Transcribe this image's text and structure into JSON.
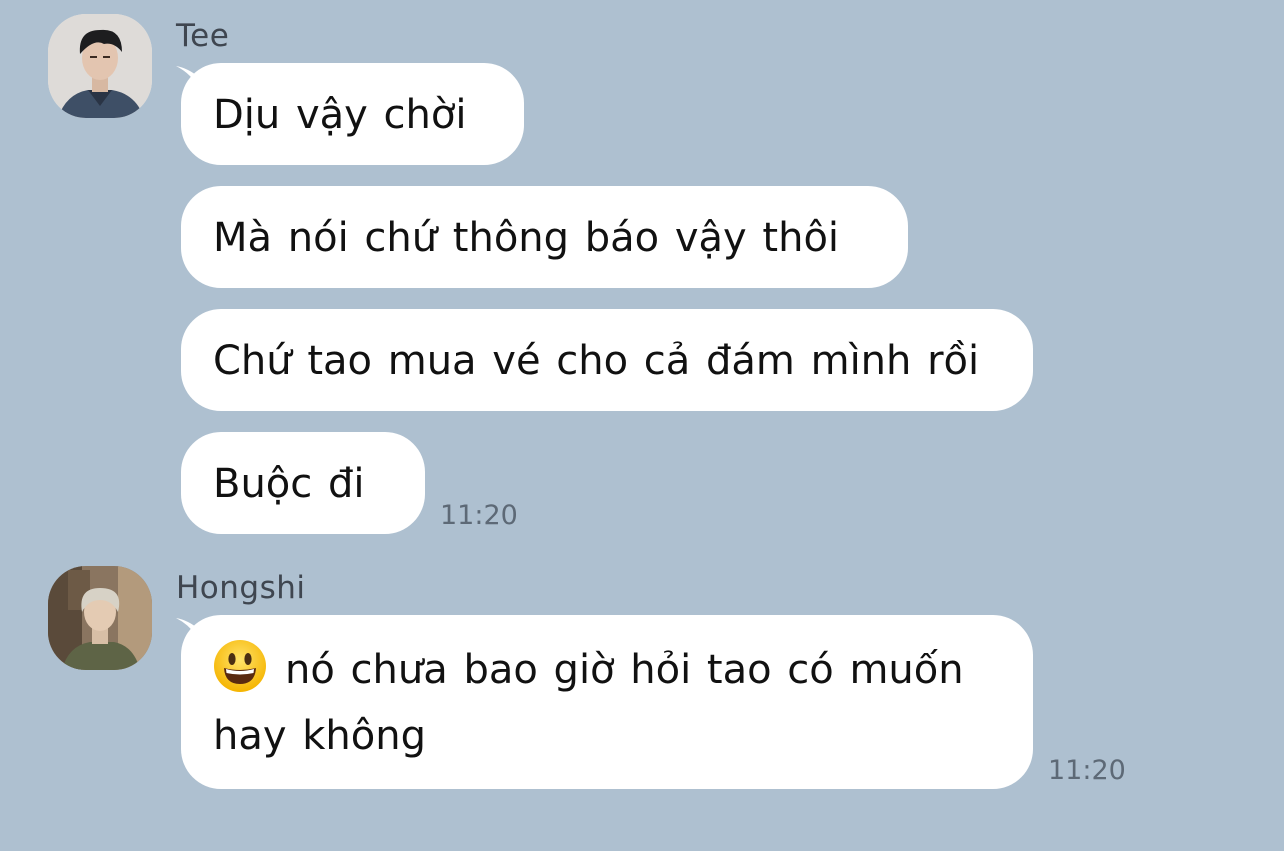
{
  "conversation": {
    "groups": [
      {
        "sender": "Tee",
        "avatar_icon": "avatar-tee",
        "messages": [
          {
            "text": "Dịu vậy chời"
          },
          {
            "text": "Mà nói chứ thông báo vậy thôi"
          },
          {
            "text": "Chứ tao mua vé cho cả đám mình rồi"
          },
          {
            "text": "Buộc đi"
          }
        ],
        "time": "11:20"
      },
      {
        "sender": "Hongshi",
        "avatar_icon": "avatar-hongshi",
        "messages": [
          {
            "emoji_icon": "grinning-face-emoji",
            "line1": "nó chưa bao giờ hỏi tao có muốn",
            "line2": "hay không"
          }
        ],
        "time": "11:20"
      }
    ]
  },
  "colors": {
    "background": "#aec0d0",
    "bubble": "#ffffff",
    "text": "#111111",
    "meta_text": "#5d6976"
  }
}
